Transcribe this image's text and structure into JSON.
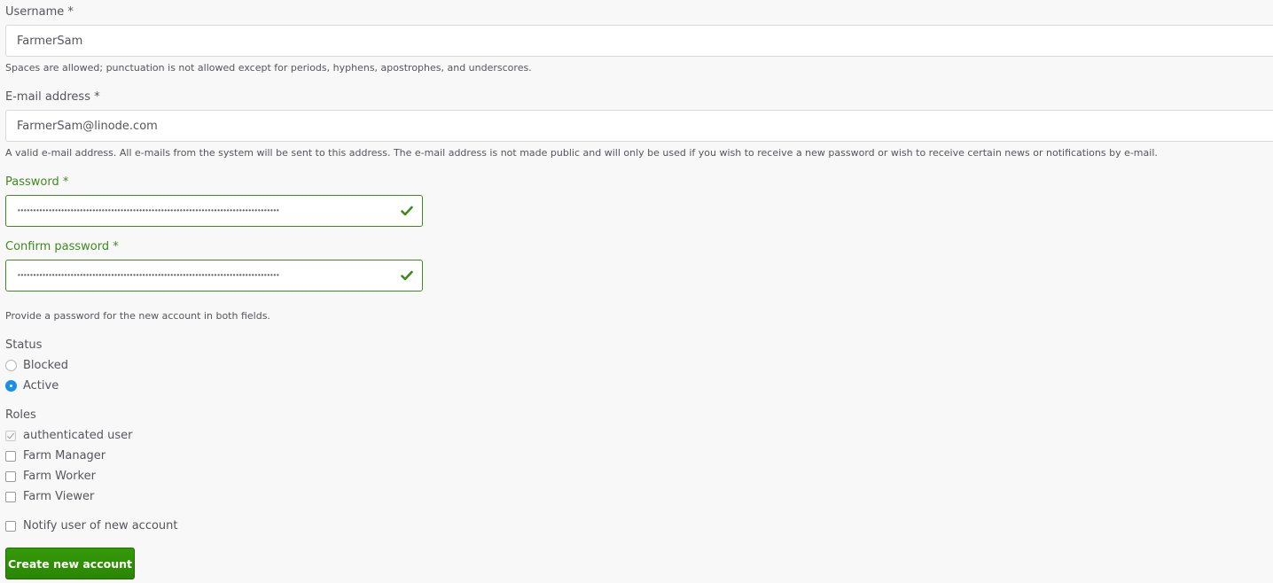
{
  "colors": {
    "valid_green": "#3f8a1e",
    "radio_accent": "#1a8fe8",
    "button_green": "#2f8f05"
  },
  "username": {
    "label": "Username *",
    "value": "FarmerSam",
    "description": "Spaces are allowed; punctuation is not allowed except for periods, hyphens, apostrophes, and underscores."
  },
  "email": {
    "label": "E-mail address *",
    "value": "FarmerSam@linode.com",
    "description": "A valid e-mail address. All e-mails from the system will be sent to this address. The e-mail address is not made public and will only be used if you wish to receive a new password or wish to receive certain news or notifications by e-mail."
  },
  "password": {
    "label": "Password *",
    "masked_value": "••••••••••••••••••••••••••••••••••••••••••••••••••••••••••••••••••••••••••••••••••••",
    "status_icon": "check-icon"
  },
  "confirm_password": {
    "label": "Confirm password *",
    "masked_value": "••••••••••••••••••••••••••••••••••••••••••••••••••••••••••••••••••••••••••••••••••••",
    "status_icon": "check-icon"
  },
  "password_description": "Provide a password for the new account in both fields.",
  "status": {
    "label": "Status",
    "options": [
      {
        "label": "Blocked",
        "checked": false
      },
      {
        "label": "Active",
        "checked": true
      }
    ]
  },
  "roles": {
    "label": "Roles",
    "options": [
      {
        "label": "authenticated user",
        "checked": true,
        "disabled": true
      },
      {
        "label": "Farm Manager",
        "checked": false
      },
      {
        "label": "Farm Worker",
        "checked": false
      },
      {
        "label": "Farm Viewer",
        "checked": false
      }
    ]
  },
  "notify": {
    "label": "Notify user of new account",
    "checked": false
  },
  "submit_label": "Create new account"
}
